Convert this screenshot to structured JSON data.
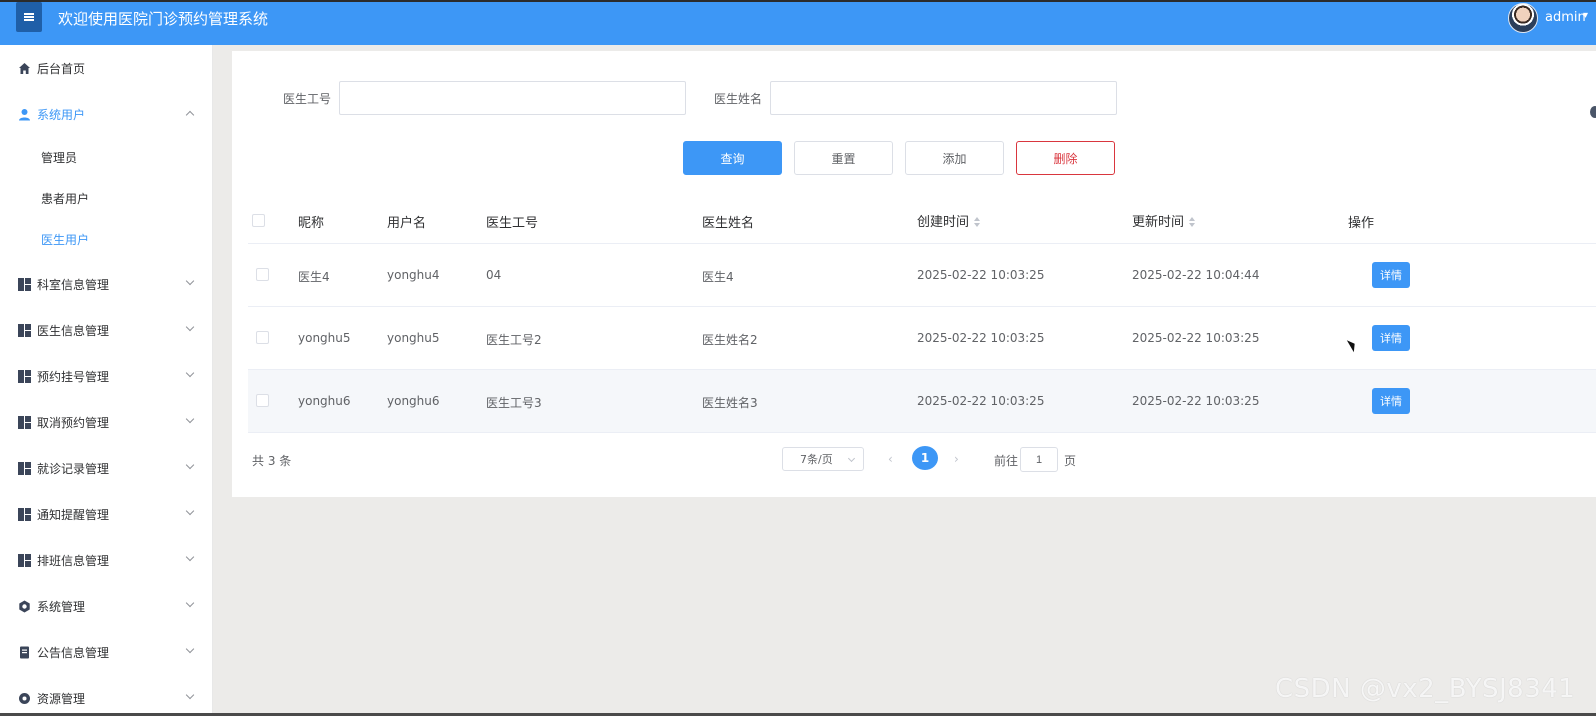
{
  "header": {
    "title": "欢迎使用医院门诊预约管理系统",
    "user": "admin"
  },
  "sidebar": {
    "items": [
      {
        "label": "后台首页",
        "icon": "home-icon"
      },
      {
        "label": "系统用户",
        "icon": "user-icon",
        "open": true
      },
      {
        "label": "科室信息管理",
        "icon": "grid-icon"
      },
      {
        "label": "医生信息管理",
        "icon": "grid-icon"
      },
      {
        "label": "预约挂号管理",
        "icon": "grid-icon"
      },
      {
        "label": "取消预约管理",
        "icon": "grid-icon"
      },
      {
        "label": "就诊记录管理",
        "icon": "grid-icon"
      },
      {
        "label": "通知提醒管理",
        "icon": "grid-icon"
      },
      {
        "label": "排班信息管理",
        "icon": "grid-icon"
      },
      {
        "label": "系统管理",
        "icon": "gear-icon"
      },
      {
        "label": "公告信息管理",
        "icon": "document-icon"
      },
      {
        "label": "资源管理",
        "icon": "gear-icon"
      }
    ],
    "subitems": [
      {
        "label": "管理员"
      },
      {
        "label": "患者用户"
      },
      {
        "label": "医生用户",
        "active": true
      }
    ]
  },
  "search": {
    "doctor_id_label": "医生工号",
    "doctor_id_value": "",
    "doctor_name_label": "医生姓名",
    "doctor_name_value": ""
  },
  "buttons": {
    "query": "查询",
    "reset": "重置",
    "add": "添加",
    "delete": "删除"
  },
  "table": {
    "columns": [
      "昵称",
      "用户名",
      "医生工号",
      "医生姓名",
      "创建时间",
      "更新时间",
      "操作"
    ],
    "rows": [
      {
        "nickname": "医生4",
        "username": "yonghu4",
        "doctor_id": "04",
        "doctor_name": "医生4",
        "created": "2025-02-22 10:03:25",
        "updated": "2025-02-22 10:04:44",
        "action": "详情"
      },
      {
        "nickname": "yonghu5",
        "username": "yonghu5",
        "doctor_id": "医生工号2",
        "doctor_name": "医生姓名2",
        "created": "2025-02-22 10:03:25",
        "updated": "2025-02-22 10:03:25",
        "action": "详情"
      },
      {
        "nickname": "yonghu6",
        "username": "yonghu6",
        "doctor_id": "医生工号3",
        "doctor_name": "医生姓名3",
        "created": "2025-02-22 10:03:25",
        "updated": "2025-02-22 10:03:25",
        "action": "详情"
      }
    ]
  },
  "pagination": {
    "total": "共 3 条",
    "page_size": "7条/页",
    "current_page": "1",
    "prev": "‹",
    "next": "›",
    "goto_label": "前往",
    "goto_value": "1",
    "page_unit": "页"
  },
  "watermark": "CSDN @vx2_BYSJ8341",
  "colors": {
    "accent": "#3d97f6",
    "danger": "#d9363e"
  }
}
